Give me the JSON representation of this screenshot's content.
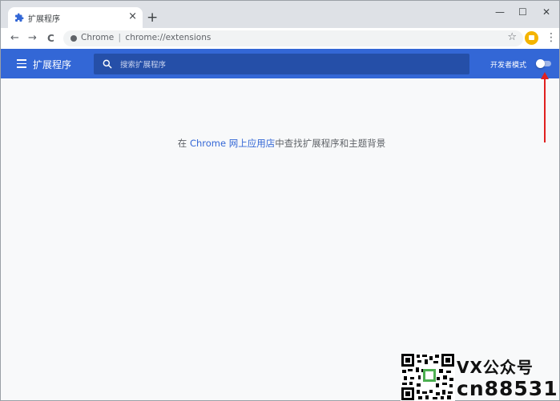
{
  "tab": {
    "title": "扩展程序",
    "close": "×"
  },
  "newtab": "+",
  "window_controls": {
    "minimize": "—",
    "maximize": "☐",
    "close": "✕"
  },
  "nav": {
    "back": "←",
    "forward": "→",
    "reload": "C"
  },
  "omnibox": {
    "site": "Chrome",
    "separator": "|",
    "url": "chrome://extensions",
    "star": "☆"
  },
  "toolbar": {
    "menu": "⋮"
  },
  "header": {
    "title": "扩展程序",
    "search_placeholder": "搜索扩展程序",
    "developer_mode_label": "开发者模式",
    "developer_mode_on": false
  },
  "main": {
    "message_prefix": "在 ",
    "message_link": "Chrome 网上应用店",
    "message_suffix": "中查找扩展程序和主题背景"
  },
  "watermark": {
    "line1": "VX公众号",
    "line2": "cn88531"
  },
  "colors": {
    "header": "#3367d6",
    "annotation_arrow": "#e02020"
  }
}
